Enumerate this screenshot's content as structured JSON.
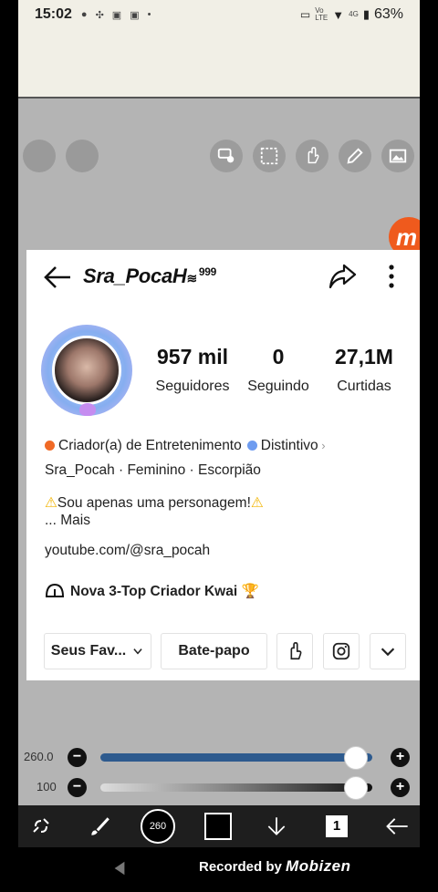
{
  "status_bar": {
    "time": "15:02",
    "network_top": "Vo",
    "network_bottom": "LTE",
    "signal_4g": "4G",
    "battery": "63%"
  },
  "profile": {
    "username": "Sra_PocaH",
    "username_suffix": "999",
    "stats": [
      {
        "value": "957 mil",
        "label": "Seguidores"
      },
      {
        "value": "0",
        "label": "Seguindo"
      },
      {
        "value": "27,1M",
        "label": "Curtidas"
      }
    ],
    "category": "Criador(a) de Entretenimento",
    "distinction": "Distintivo",
    "details": "Sra_Pocah · Feminino · Escorpião",
    "bio": "Sou apenas uma personagem!",
    "more": "... Mais",
    "link": "youtube.com/@sra_pocah",
    "badge_text": "Nova 3-Top Criador Kwai",
    "buttons": {
      "favorites": "Seus Fav...",
      "chat": "Bate-papo"
    }
  },
  "sliders": {
    "size_value": "260.0",
    "size_fraction": 0.94,
    "opacity_value": "100",
    "opacity_fraction": 0.94
  },
  "bottom_bar": {
    "brush_size": "260",
    "layer_count": "1",
    "color": "#000000"
  },
  "recorder": {
    "text": "Recorded by",
    "brand": "Mobizen"
  },
  "colors": {
    "accent_orange": "#ef5a1d",
    "slider_blue": "#2d5a8e"
  }
}
